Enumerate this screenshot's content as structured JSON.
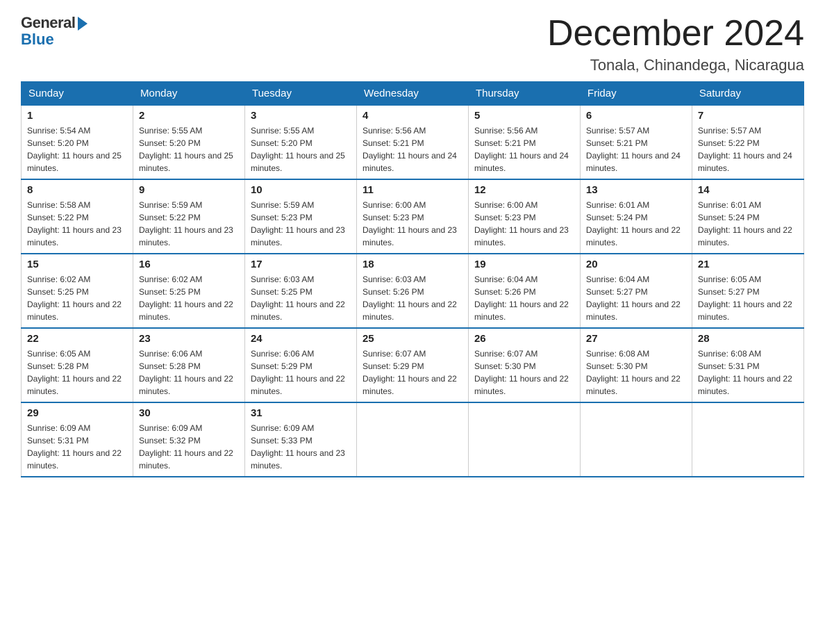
{
  "logo": {
    "general": "General",
    "blue": "Blue"
  },
  "header": {
    "month": "December 2024",
    "location": "Tonala, Chinandega, Nicaragua"
  },
  "days_of_week": [
    "Sunday",
    "Monday",
    "Tuesday",
    "Wednesday",
    "Thursday",
    "Friday",
    "Saturday"
  ],
  "weeks": [
    [
      {
        "day": "1",
        "sunrise": "5:54 AM",
        "sunset": "5:20 PM",
        "daylight": "11 hours and 25 minutes."
      },
      {
        "day": "2",
        "sunrise": "5:55 AM",
        "sunset": "5:20 PM",
        "daylight": "11 hours and 25 minutes."
      },
      {
        "day": "3",
        "sunrise": "5:55 AM",
        "sunset": "5:20 PM",
        "daylight": "11 hours and 25 minutes."
      },
      {
        "day": "4",
        "sunrise": "5:56 AM",
        "sunset": "5:21 PM",
        "daylight": "11 hours and 24 minutes."
      },
      {
        "day": "5",
        "sunrise": "5:56 AM",
        "sunset": "5:21 PM",
        "daylight": "11 hours and 24 minutes."
      },
      {
        "day": "6",
        "sunrise": "5:57 AM",
        "sunset": "5:21 PM",
        "daylight": "11 hours and 24 minutes."
      },
      {
        "day": "7",
        "sunrise": "5:57 AM",
        "sunset": "5:22 PM",
        "daylight": "11 hours and 24 minutes."
      }
    ],
    [
      {
        "day": "8",
        "sunrise": "5:58 AM",
        "sunset": "5:22 PM",
        "daylight": "11 hours and 23 minutes."
      },
      {
        "day": "9",
        "sunrise": "5:59 AM",
        "sunset": "5:22 PM",
        "daylight": "11 hours and 23 minutes."
      },
      {
        "day": "10",
        "sunrise": "5:59 AM",
        "sunset": "5:23 PM",
        "daylight": "11 hours and 23 minutes."
      },
      {
        "day": "11",
        "sunrise": "6:00 AM",
        "sunset": "5:23 PM",
        "daylight": "11 hours and 23 minutes."
      },
      {
        "day": "12",
        "sunrise": "6:00 AM",
        "sunset": "5:23 PM",
        "daylight": "11 hours and 23 minutes."
      },
      {
        "day": "13",
        "sunrise": "6:01 AM",
        "sunset": "5:24 PM",
        "daylight": "11 hours and 22 minutes."
      },
      {
        "day": "14",
        "sunrise": "6:01 AM",
        "sunset": "5:24 PM",
        "daylight": "11 hours and 22 minutes."
      }
    ],
    [
      {
        "day": "15",
        "sunrise": "6:02 AM",
        "sunset": "5:25 PM",
        "daylight": "11 hours and 22 minutes."
      },
      {
        "day": "16",
        "sunrise": "6:02 AM",
        "sunset": "5:25 PM",
        "daylight": "11 hours and 22 minutes."
      },
      {
        "day": "17",
        "sunrise": "6:03 AM",
        "sunset": "5:25 PM",
        "daylight": "11 hours and 22 minutes."
      },
      {
        "day": "18",
        "sunrise": "6:03 AM",
        "sunset": "5:26 PM",
        "daylight": "11 hours and 22 minutes."
      },
      {
        "day": "19",
        "sunrise": "6:04 AM",
        "sunset": "5:26 PM",
        "daylight": "11 hours and 22 minutes."
      },
      {
        "day": "20",
        "sunrise": "6:04 AM",
        "sunset": "5:27 PM",
        "daylight": "11 hours and 22 minutes."
      },
      {
        "day": "21",
        "sunrise": "6:05 AM",
        "sunset": "5:27 PM",
        "daylight": "11 hours and 22 minutes."
      }
    ],
    [
      {
        "day": "22",
        "sunrise": "6:05 AM",
        "sunset": "5:28 PM",
        "daylight": "11 hours and 22 minutes."
      },
      {
        "day": "23",
        "sunrise": "6:06 AM",
        "sunset": "5:28 PM",
        "daylight": "11 hours and 22 minutes."
      },
      {
        "day": "24",
        "sunrise": "6:06 AM",
        "sunset": "5:29 PM",
        "daylight": "11 hours and 22 minutes."
      },
      {
        "day": "25",
        "sunrise": "6:07 AM",
        "sunset": "5:29 PM",
        "daylight": "11 hours and 22 minutes."
      },
      {
        "day": "26",
        "sunrise": "6:07 AM",
        "sunset": "5:30 PM",
        "daylight": "11 hours and 22 minutes."
      },
      {
        "day": "27",
        "sunrise": "6:08 AM",
        "sunset": "5:30 PM",
        "daylight": "11 hours and 22 minutes."
      },
      {
        "day": "28",
        "sunrise": "6:08 AM",
        "sunset": "5:31 PM",
        "daylight": "11 hours and 22 minutes."
      }
    ],
    [
      {
        "day": "29",
        "sunrise": "6:09 AM",
        "sunset": "5:31 PM",
        "daylight": "11 hours and 22 minutes."
      },
      {
        "day": "30",
        "sunrise": "6:09 AM",
        "sunset": "5:32 PM",
        "daylight": "11 hours and 22 minutes."
      },
      {
        "day": "31",
        "sunrise": "6:09 AM",
        "sunset": "5:33 PM",
        "daylight": "11 hours and 23 minutes."
      },
      null,
      null,
      null,
      null
    ]
  ]
}
